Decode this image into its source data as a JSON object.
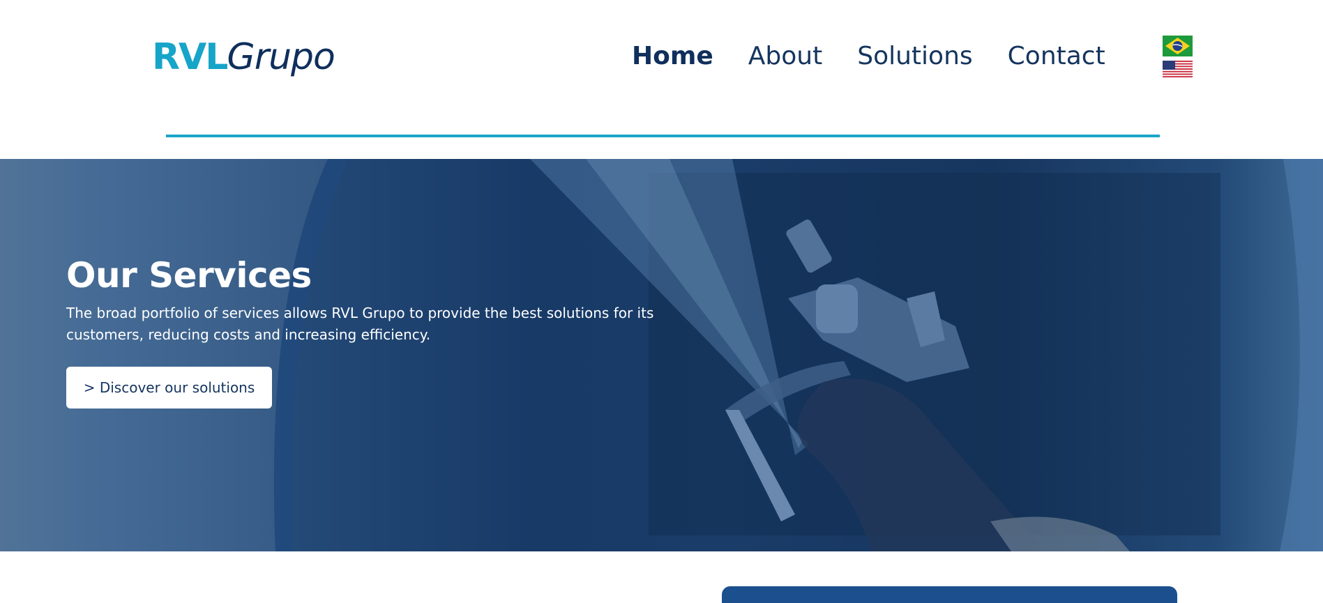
{
  "header": {
    "logo": {
      "part1": "RVL",
      "part2": "Grupo"
    },
    "nav": [
      {
        "label": "Home",
        "active": true
      },
      {
        "label": "About",
        "active": false
      },
      {
        "label": "Solutions",
        "active": false
      },
      {
        "label": "Contact",
        "active": false
      }
    ],
    "languages": [
      {
        "icon": "brazil-flag-icon"
      },
      {
        "icon": "us-flag-icon"
      }
    ]
  },
  "hero": {
    "title": "Our Services",
    "description": "The broad portfolio of services allows RVL Grupo to provide the best solutions for its customers, reducing costs and increasing efficiency.",
    "cta_label": "> Discover our solutions"
  },
  "colors": {
    "brand_cyan": "#17a4c9",
    "brand_navy": "#0f2f5c",
    "hero_overlay": "#183a67"
  }
}
